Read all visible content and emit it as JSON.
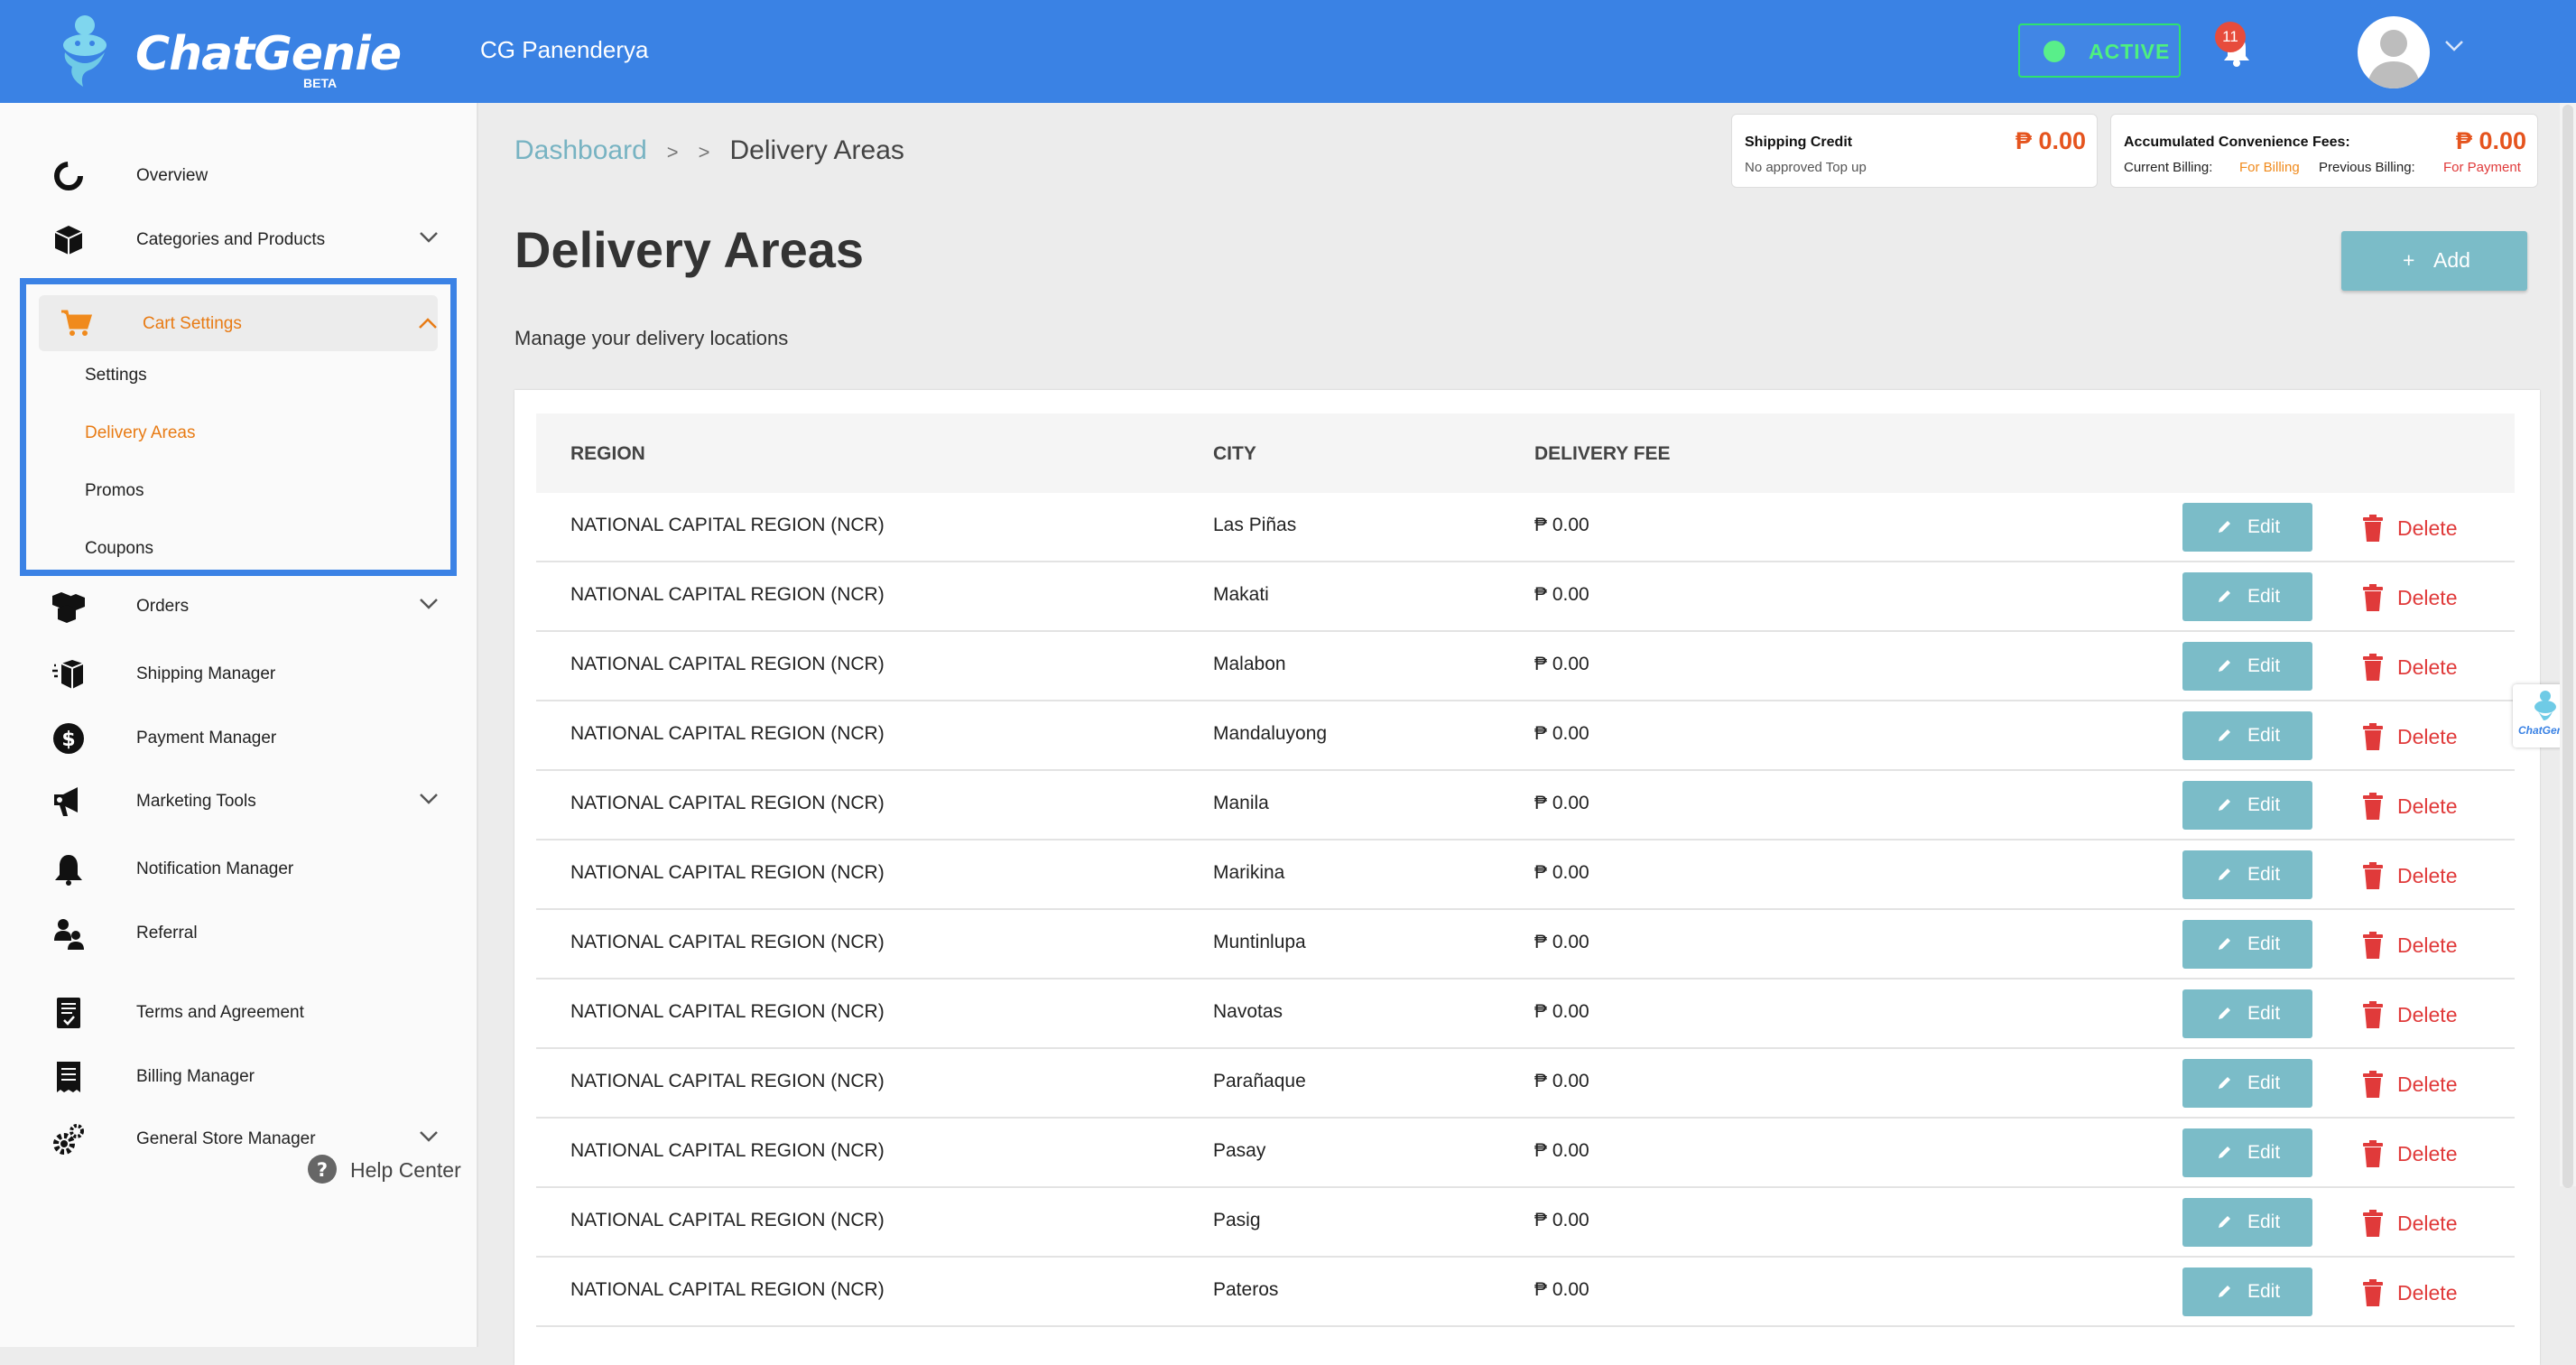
{
  "app": {
    "logo_text": "ChatGenie",
    "logo_badge": "BETA",
    "store_name": "CG Panenderya",
    "status": "ACTIVE",
    "notification_count": "11"
  },
  "colors": {
    "topbar": "#3a82e4",
    "accent_orange": "#e5541e",
    "button_teal": "#7bbcc8",
    "delete_red": "#e03a3a",
    "active_green": "#4ef07f"
  },
  "sidebar": {
    "items": [
      {
        "label": "Overview",
        "icon": "overview-icon"
      },
      {
        "label": "Categories and Products",
        "icon": "box-icon"
      },
      {
        "label": "Cart Settings",
        "icon": "cart-icon"
      },
      {
        "label": "Orders",
        "icon": "orders-icon"
      },
      {
        "label": "Shipping Manager",
        "icon": "shipping-icon"
      },
      {
        "label": "Payment Manager",
        "icon": "dollar-icon"
      },
      {
        "label": "Marketing Tools",
        "icon": "megaphone-icon"
      },
      {
        "label": "Notification Manager",
        "icon": "bell-icon"
      },
      {
        "label": "Referral",
        "icon": "referral-icon"
      },
      {
        "label": "Terms and Agreement",
        "icon": "document-icon"
      },
      {
        "label": "Billing Manager",
        "icon": "receipt-icon"
      },
      {
        "label": "General Store Manager",
        "icon": "gears-icon"
      }
    ],
    "cart_sub_items": [
      "Settings",
      "Delivery Areas",
      "Promos",
      "Coupons"
    ],
    "help_label": "Help Center"
  },
  "breadcrumb": {
    "root": "Dashboard",
    "sep1": ">",
    "sep2": ">",
    "current": "Delivery Areas"
  },
  "shipping_credit": {
    "title": "Shipping Credit",
    "amount": "₱ 0.00",
    "note": "No approved Top up"
  },
  "convenience_fees": {
    "title": "Accumulated Convenience Fees:",
    "amount": "₱ 0.00",
    "current_label": "Current Billing:",
    "current_value": "For Billing",
    "previous_label": "Previous Billing:",
    "previous_value": "For Payment"
  },
  "page": {
    "title": "Delivery Areas",
    "subtitle": "Manage your delivery locations",
    "add_label": "Add",
    "add_symbol": "+"
  },
  "table": {
    "headers": [
      "REGION",
      "CITY",
      "DELIVERY FEE"
    ],
    "edit_label": "Edit",
    "delete_label": "Delete",
    "rows": [
      {
        "region": "NATIONAL CAPITAL REGION (NCR)",
        "city": "Las Piñas",
        "fee": "₱ 0.00"
      },
      {
        "region": "NATIONAL CAPITAL REGION (NCR)",
        "city": "Makati",
        "fee": "₱ 0.00"
      },
      {
        "region": "NATIONAL CAPITAL REGION (NCR)",
        "city": "Malabon",
        "fee": "₱ 0.00"
      },
      {
        "region": "NATIONAL CAPITAL REGION (NCR)",
        "city": "Mandaluyong",
        "fee": "₱ 0.00"
      },
      {
        "region": "NATIONAL CAPITAL REGION (NCR)",
        "city": "Manila",
        "fee": "₱ 0.00"
      },
      {
        "region": "NATIONAL CAPITAL REGION (NCR)",
        "city": "Marikina",
        "fee": "₱ 0.00"
      },
      {
        "region": "NATIONAL CAPITAL REGION (NCR)",
        "city": "Muntinlupa",
        "fee": "₱ 0.00"
      },
      {
        "region": "NATIONAL CAPITAL REGION (NCR)",
        "city": "Navotas",
        "fee": "₱ 0.00"
      },
      {
        "region": "NATIONAL CAPITAL REGION (NCR)",
        "city": "Parañaque",
        "fee": "₱ 0.00"
      },
      {
        "region": "NATIONAL CAPITAL REGION (NCR)",
        "city": "Pasay",
        "fee": "₱ 0.00"
      },
      {
        "region": "NATIONAL CAPITAL REGION (NCR)",
        "city": "Pasig",
        "fee": "₱ 0.00"
      },
      {
        "region": "NATIONAL CAPITAL REGION (NCR)",
        "city": "Pateros",
        "fee": "₱ 0.00"
      }
    ]
  }
}
